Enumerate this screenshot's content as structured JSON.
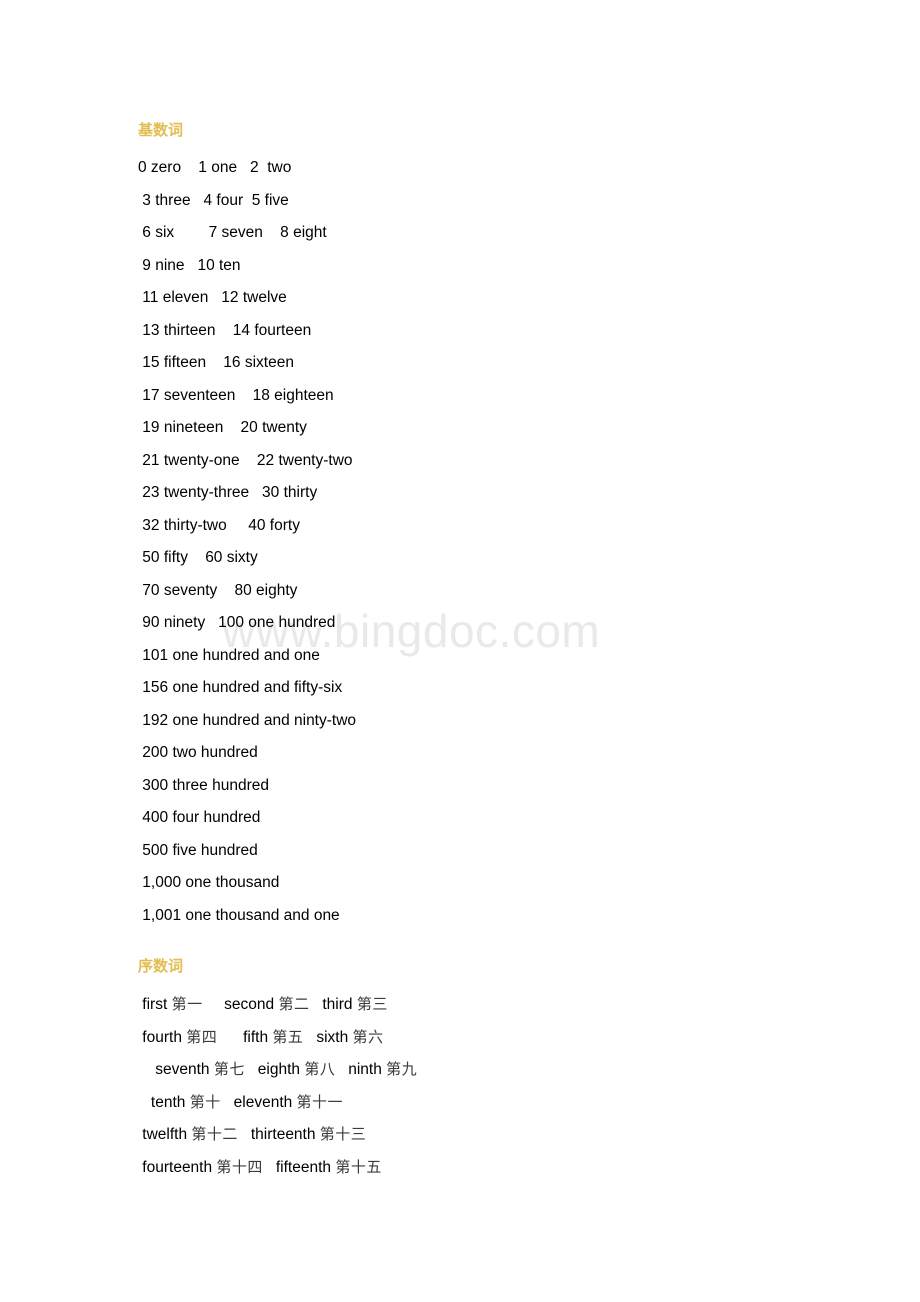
{
  "document": {
    "background_color": "#ffffff",
    "text_color": "#000000",
    "heading_color": "#e2bd51",
    "watermark_color": "#e9e9e9"
  },
  "watermark": {
    "text": "www.bingdoc.com"
  },
  "cardinal_section": {
    "heading": "基数词",
    "lines": [
      "0 zero    1 one   2  two",
      " 3 three   4 four  5 five",
      " 6 six        7 seven    8 eight",
      " 9 nine   10 ten",
      " 11 eleven   12 twelve",
      " 13 thirteen    14 fourteen",
      " 15 fifteen    16 sixteen",
      " 17 seventeen    18 eighteen",
      " 19 nineteen    20 twenty",
      " 21 twenty-one    22 twenty-two",
      " 23 twenty-three   30 thirty",
      " 32 thirty-two     40 forty",
      " 50 fifty    60 sixty",
      " 70 seventy    80 eighty",
      " 90 ninety   100 one hundred",
      " 101 one hundred and one",
      " 156 one hundred and fifty-six",
      " 192 one hundred and ninty-two",
      " 200 two hundred",
      " 300 three hundred",
      " 400 four hundred",
      " 500 five hundred",
      " 1,000 one thousand",
      " 1,001 one thousand and one"
    ]
  },
  "ordinal_section": {
    "heading": "序数词",
    "lines": [
      [
        {
          "t": " first ",
          "cn": false
        },
        {
          "t": "第一",
          "cn": true
        },
        {
          "t": "     second ",
          "cn": false
        },
        {
          "t": "第二",
          "cn": true
        },
        {
          "t": "   third ",
          "cn": false
        },
        {
          "t": "第三",
          "cn": true
        }
      ],
      [
        {
          "t": " fourth ",
          "cn": false
        },
        {
          "t": "第四",
          "cn": true
        },
        {
          "t": "      fifth ",
          "cn": false
        },
        {
          "t": "第五",
          "cn": true
        },
        {
          "t": "   sixth ",
          "cn": false
        },
        {
          "t": "第六",
          "cn": true
        }
      ],
      [
        {
          "t": "    seventh ",
          "cn": false
        },
        {
          "t": "第七",
          "cn": true
        },
        {
          "t": "   eighth ",
          "cn": false
        },
        {
          "t": "第八",
          "cn": true
        },
        {
          "t": "   ninth ",
          "cn": false
        },
        {
          "t": "第九",
          "cn": true
        }
      ],
      [
        {
          "t": "   tenth ",
          "cn": false
        },
        {
          "t": "第十",
          "cn": true
        },
        {
          "t": "   eleventh ",
          "cn": false
        },
        {
          "t": "第十一",
          "cn": true
        }
      ],
      [
        {
          "t": " twelfth ",
          "cn": false
        },
        {
          "t": "第十二",
          "cn": true
        },
        {
          "t": "   thirteenth ",
          "cn": false
        },
        {
          "t": "第十三",
          "cn": true
        }
      ],
      [
        {
          "t": " fourteenth ",
          "cn": false
        },
        {
          "t": "第十四",
          "cn": true
        },
        {
          "t": "   fifteenth ",
          "cn": false
        },
        {
          "t": "第十五",
          "cn": true
        }
      ]
    ]
  }
}
